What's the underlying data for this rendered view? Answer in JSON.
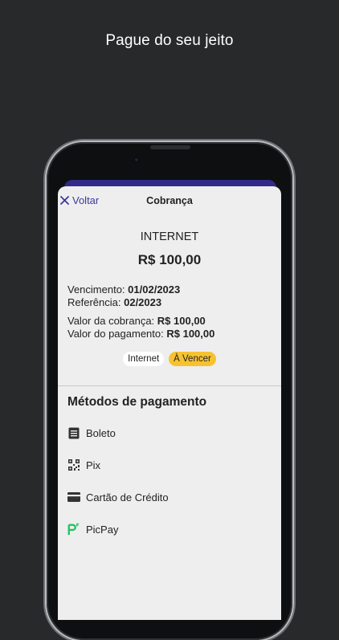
{
  "headline": "Pague do seu jeito",
  "nav": {
    "back_label": "Voltar",
    "title": "Cobrança"
  },
  "bill": {
    "service": "INTERNET",
    "amount": "R$ 100,00",
    "due_label": "Vencimento:",
    "due_value": "01/02/2023",
    "ref_label": "Referência:",
    "ref_value": "02/2023",
    "charge_label": "Valor da cobrança:",
    "charge_value": "R$ 100,00",
    "paid_label": "Valor do pagamento:",
    "paid_value": "R$ 100,00",
    "tags": [
      "Internet",
      "À Vencer"
    ]
  },
  "methods": {
    "title": "Métodos de pagamento",
    "items": [
      {
        "label": "Boleto",
        "icon": "boleto-icon"
      },
      {
        "label": "Pix",
        "icon": "qr-code-icon"
      },
      {
        "label": "Cartão de Crédito",
        "icon": "credit-card-icon"
      },
      {
        "label": "PicPay",
        "icon": "picpay-icon"
      }
    ]
  },
  "colors": {
    "background": "#27292b",
    "accent": "#322a8a",
    "warning": "#f6c232",
    "picpay": "#21c25e"
  }
}
